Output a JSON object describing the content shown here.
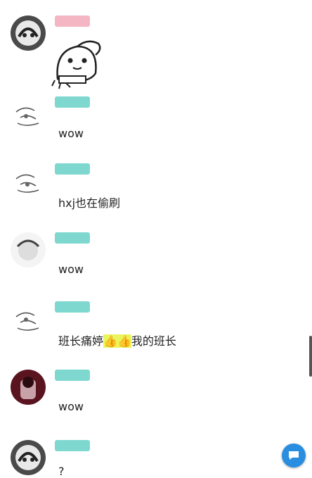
{
  "messages": [
    {
      "badge": "",
      "meta": "",
      "content": "",
      "sticker_icon": "cartoon-ghost-sticker"
    },
    {
      "badge": "",
      "meta": "",
      "content": "wow"
    },
    {
      "badge": "",
      "meta": "",
      "content": "hxj也在偷刷"
    },
    {
      "badge": "",
      "meta": "",
      "content": "wow"
    },
    {
      "badge": "",
      "meta": "",
      "content_prefix": "班长痛婷",
      "content_highlight": "👍👍",
      "content_suffix": "我的班长"
    },
    {
      "badge": "",
      "meta": "",
      "content": "wow"
    },
    {
      "badge": "",
      "meta": "",
      "content": "?"
    }
  ],
  "colors": {
    "badge_teal": "#7fd8d0",
    "badge_pink": "#f4b6c2",
    "highlight": "#e9f55a",
    "fab": "#2a8ee0"
  },
  "fab_icon": "chat-bubble-icon"
}
